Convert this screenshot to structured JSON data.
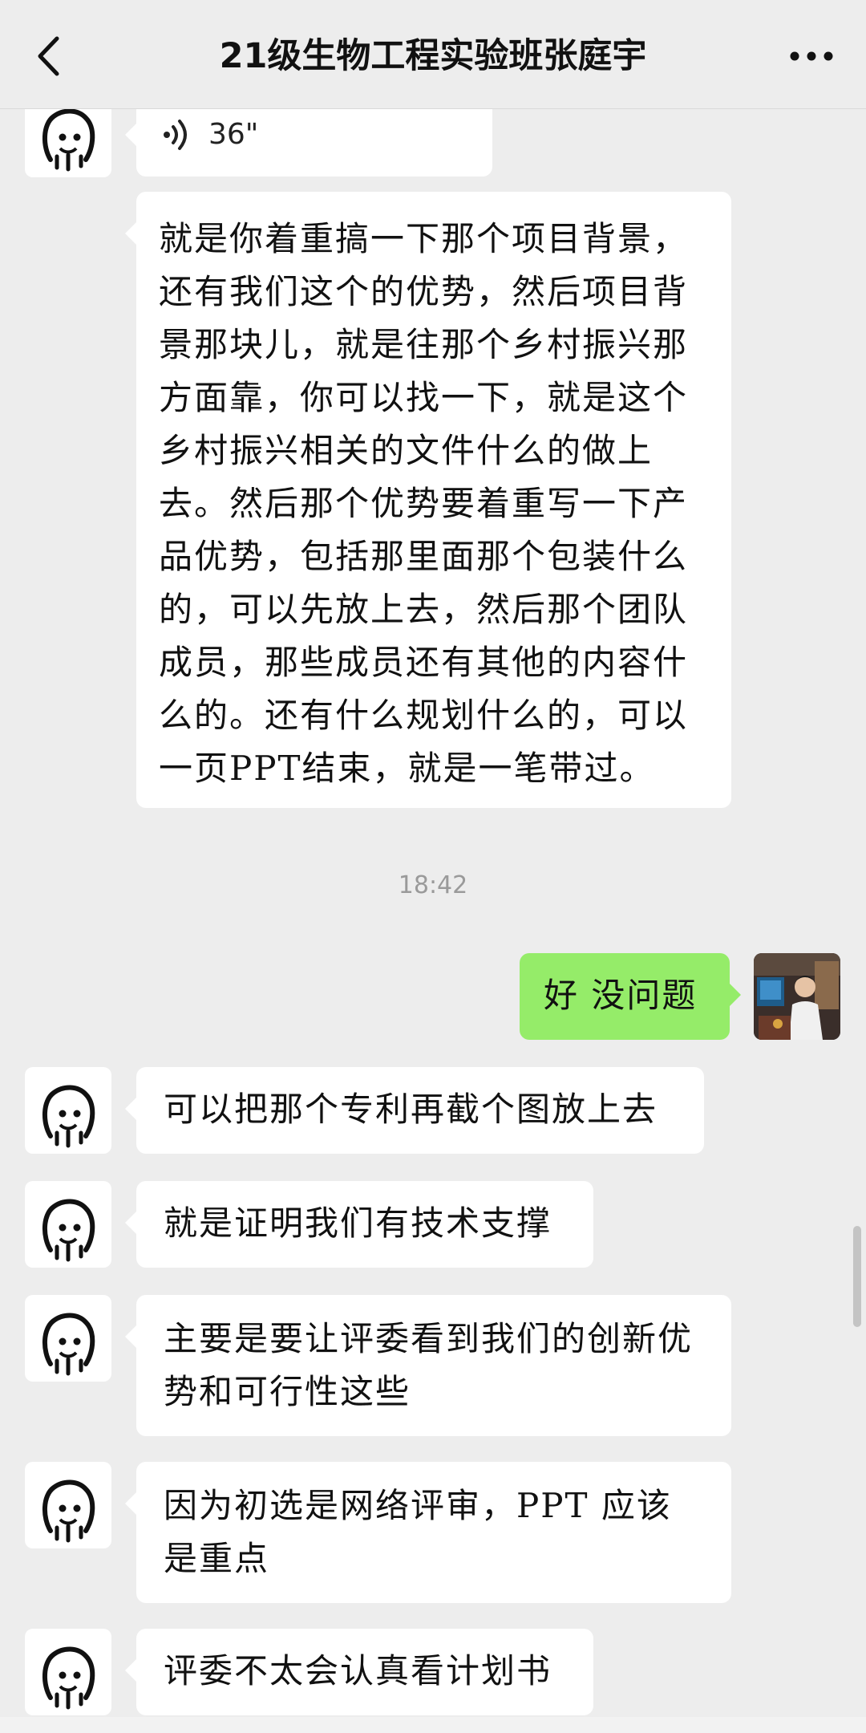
{
  "header": {
    "back_icon": "chevron-left-icon",
    "title": "21级生物工程实验班张庭宇",
    "more_icon": "more-dots-icon"
  },
  "messages": [
    {
      "type": "voice",
      "side": "left",
      "duration": "36\"",
      "icon": "voice-waves-icon"
    },
    {
      "type": "text",
      "side": "left",
      "text": "就是你着重搞一下那个项目背景，还有我们这个的优势，然后项目背景那块儿，就是往那个乡村振兴那方面靠，你可以找一下，就是这个乡村振兴相关的文件什么的做上去。然后那个优势要着重写一下产品优势，包括那里面那个包装什么的，可以先放上去，然后那个团队成员，那些成员还有其他的内容什么的。还有什么规划什么的，可以一页PPT结束，就是一笔带过。"
    },
    {
      "type": "timestamp",
      "text": "18:42"
    },
    {
      "type": "text",
      "side": "right",
      "text": "好 没问题"
    },
    {
      "type": "text",
      "side": "left",
      "text": "可以把那个专利再截个图放上去"
    },
    {
      "type": "text",
      "side": "left",
      "text": "就是证明我们有技术支撑"
    },
    {
      "type": "text",
      "side": "left",
      "text": "主要是要让评委看到我们的创新优势和可行性这些"
    },
    {
      "type": "text",
      "side": "left",
      "text": "因为初选是网络评审，PPT 应该是重点"
    },
    {
      "type": "text",
      "side": "left",
      "text": "评委不太会认真看计划书"
    }
  ],
  "colors": {
    "background": "#ededed",
    "left_bubble": "#ffffff",
    "right_bubble": "#95ec69",
    "timestamp": "#9a9a9a"
  }
}
